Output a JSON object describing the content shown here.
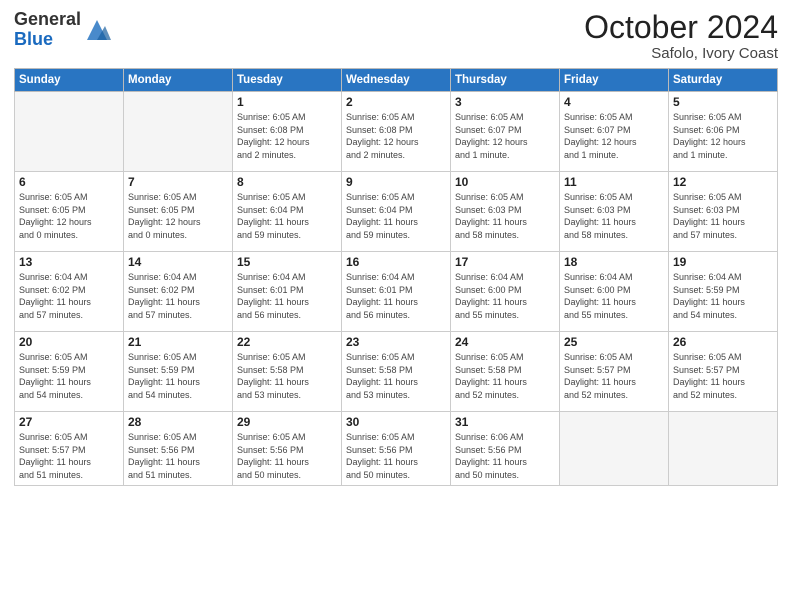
{
  "header": {
    "logo_general": "General",
    "logo_blue": "Blue",
    "month_year": "October 2024",
    "location": "Safolo, Ivory Coast"
  },
  "days_of_week": [
    "Sunday",
    "Monday",
    "Tuesday",
    "Wednesday",
    "Thursday",
    "Friday",
    "Saturday"
  ],
  "weeks": [
    [
      {
        "day": "",
        "info": ""
      },
      {
        "day": "",
        "info": ""
      },
      {
        "day": "1",
        "info": "Sunrise: 6:05 AM\nSunset: 6:08 PM\nDaylight: 12 hours\nand 2 minutes."
      },
      {
        "day": "2",
        "info": "Sunrise: 6:05 AM\nSunset: 6:08 PM\nDaylight: 12 hours\nand 2 minutes."
      },
      {
        "day": "3",
        "info": "Sunrise: 6:05 AM\nSunset: 6:07 PM\nDaylight: 12 hours\nand 1 minute."
      },
      {
        "day": "4",
        "info": "Sunrise: 6:05 AM\nSunset: 6:07 PM\nDaylight: 12 hours\nand 1 minute."
      },
      {
        "day": "5",
        "info": "Sunrise: 6:05 AM\nSunset: 6:06 PM\nDaylight: 12 hours\nand 1 minute."
      }
    ],
    [
      {
        "day": "6",
        "info": "Sunrise: 6:05 AM\nSunset: 6:05 PM\nDaylight: 12 hours\nand 0 minutes."
      },
      {
        "day": "7",
        "info": "Sunrise: 6:05 AM\nSunset: 6:05 PM\nDaylight: 12 hours\nand 0 minutes."
      },
      {
        "day": "8",
        "info": "Sunrise: 6:05 AM\nSunset: 6:04 PM\nDaylight: 11 hours\nand 59 minutes."
      },
      {
        "day": "9",
        "info": "Sunrise: 6:05 AM\nSunset: 6:04 PM\nDaylight: 11 hours\nand 59 minutes."
      },
      {
        "day": "10",
        "info": "Sunrise: 6:05 AM\nSunset: 6:03 PM\nDaylight: 11 hours\nand 58 minutes."
      },
      {
        "day": "11",
        "info": "Sunrise: 6:05 AM\nSunset: 6:03 PM\nDaylight: 11 hours\nand 58 minutes."
      },
      {
        "day": "12",
        "info": "Sunrise: 6:05 AM\nSunset: 6:03 PM\nDaylight: 11 hours\nand 57 minutes."
      }
    ],
    [
      {
        "day": "13",
        "info": "Sunrise: 6:04 AM\nSunset: 6:02 PM\nDaylight: 11 hours\nand 57 minutes."
      },
      {
        "day": "14",
        "info": "Sunrise: 6:04 AM\nSunset: 6:02 PM\nDaylight: 11 hours\nand 57 minutes."
      },
      {
        "day": "15",
        "info": "Sunrise: 6:04 AM\nSunset: 6:01 PM\nDaylight: 11 hours\nand 56 minutes."
      },
      {
        "day": "16",
        "info": "Sunrise: 6:04 AM\nSunset: 6:01 PM\nDaylight: 11 hours\nand 56 minutes."
      },
      {
        "day": "17",
        "info": "Sunrise: 6:04 AM\nSunset: 6:00 PM\nDaylight: 11 hours\nand 55 minutes."
      },
      {
        "day": "18",
        "info": "Sunrise: 6:04 AM\nSunset: 6:00 PM\nDaylight: 11 hours\nand 55 minutes."
      },
      {
        "day": "19",
        "info": "Sunrise: 6:04 AM\nSunset: 5:59 PM\nDaylight: 11 hours\nand 54 minutes."
      }
    ],
    [
      {
        "day": "20",
        "info": "Sunrise: 6:05 AM\nSunset: 5:59 PM\nDaylight: 11 hours\nand 54 minutes."
      },
      {
        "day": "21",
        "info": "Sunrise: 6:05 AM\nSunset: 5:59 PM\nDaylight: 11 hours\nand 54 minutes."
      },
      {
        "day": "22",
        "info": "Sunrise: 6:05 AM\nSunset: 5:58 PM\nDaylight: 11 hours\nand 53 minutes."
      },
      {
        "day": "23",
        "info": "Sunrise: 6:05 AM\nSunset: 5:58 PM\nDaylight: 11 hours\nand 53 minutes."
      },
      {
        "day": "24",
        "info": "Sunrise: 6:05 AM\nSunset: 5:58 PM\nDaylight: 11 hours\nand 52 minutes."
      },
      {
        "day": "25",
        "info": "Sunrise: 6:05 AM\nSunset: 5:57 PM\nDaylight: 11 hours\nand 52 minutes."
      },
      {
        "day": "26",
        "info": "Sunrise: 6:05 AM\nSunset: 5:57 PM\nDaylight: 11 hours\nand 52 minutes."
      }
    ],
    [
      {
        "day": "27",
        "info": "Sunrise: 6:05 AM\nSunset: 5:57 PM\nDaylight: 11 hours\nand 51 minutes."
      },
      {
        "day": "28",
        "info": "Sunrise: 6:05 AM\nSunset: 5:56 PM\nDaylight: 11 hours\nand 51 minutes."
      },
      {
        "day": "29",
        "info": "Sunrise: 6:05 AM\nSunset: 5:56 PM\nDaylight: 11 hours\nand 50 minutes."
      },
      {
        "day": "30",
        "info": "Sunrise: 6:05 AM\nSunset: 5:56 PM\nDaylight: 11 hours\nand 50 minutes."
      },
      {
        "day": "31",
        "info": "Sunrise: 6:06 AM\nSunset: 5:56 PM\nDaylight: 11 hours\nand 50 minutes."
      },
      {
        "day": "",
        "info": ""
      },
      {
        "day": "",
        "info": ""
      }
    ]
  ]
}
